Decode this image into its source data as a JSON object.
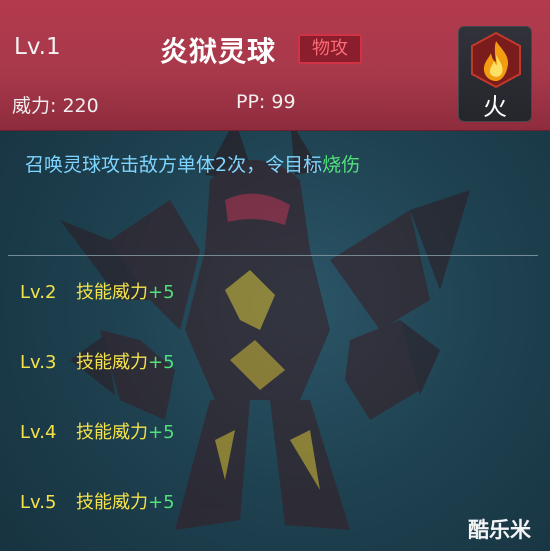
{
  "header": {
    "level": "Lv.1",
    "skill_name": "炎狱灵球",
    "type_badge": "物攻",
    "power_label": "威力: 220",
    "pp_label": "PP: 99"
  },
  "element": {
    "icon": "fire-icon",
    "label": "火"
  },
  "description": {
    "text": "召唤灵球攻击敌方单体2次，令目标",
    "highlight": "烧伤"
  },
  "upgrades": [
    {
      "level": "Lv.2",
      "text": "技能威力",
      "bonus": "+5"
    },
    {
      "level": "Lv.3",
      "text": "技能威力",
      "bonus": "+5"
    },
    {
      "level": "Lv.4",
      "text": "技能威力",
      "bonus": "+5"
    },
    {
      "level": "Lv.5",
      "text": "技能威力",
      "bonus": "+5"
    }
  ],
  "watermark": "酷乐米",
  "colors": {
    "header_bg": "#a8394b",
    "badge_text": "#ff6a78",
    "description": "#7fd5ff",
    "highlight_green": "#52e07a",
    "upgrade_yellow": "#f5e24a"
  }
}
